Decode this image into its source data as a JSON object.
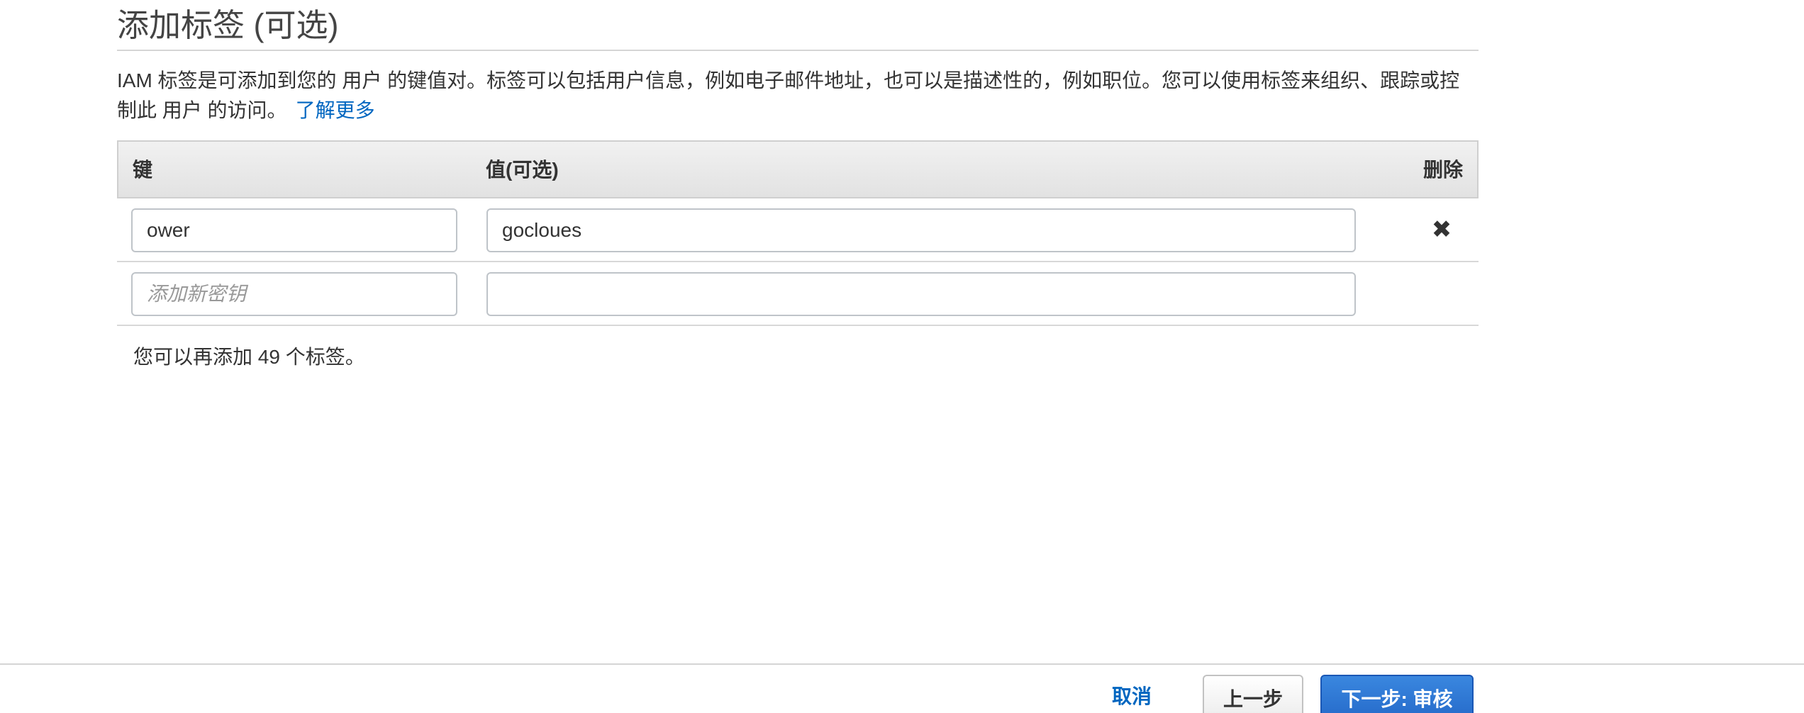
{
  "section": {
    "title": "添加标签 (可选)",
    "description": "IAM 标签是可添加到您的 用户 的键值对。标签可以包括用户信息，例如电子邮件地址，也可以是描述性的，例如职位。您可以使用标签来组织、跟踪或控制此 用户 的访问。",
    "learn_more": "了解更多"
  },
  "table": {
    "headers": {
      "key": "键",
      "value": "值(可选)",
      "remove": "删除"
    },
    "rows": [
      {
        "key": "ower",
        "value": "gocloues"
      }
    ],
    "new_row": {
      "key_placeholder": "添加新密钥",
      "value": ""
    }
  },
  "remaining_text": "您可以再添加 49 个标签。",
  "icons": {
    "remove": "close-x-icon"
  },
  "footer": {
    "cancel": "取消",
    "previous": "上一步",
    "next": "下一步: 审核"
  },
  "colors": {
    "link": "#0066c0",
    "primary_button": "#2468c8",
    "header_bg": "#e6e6e6"
  }
}
